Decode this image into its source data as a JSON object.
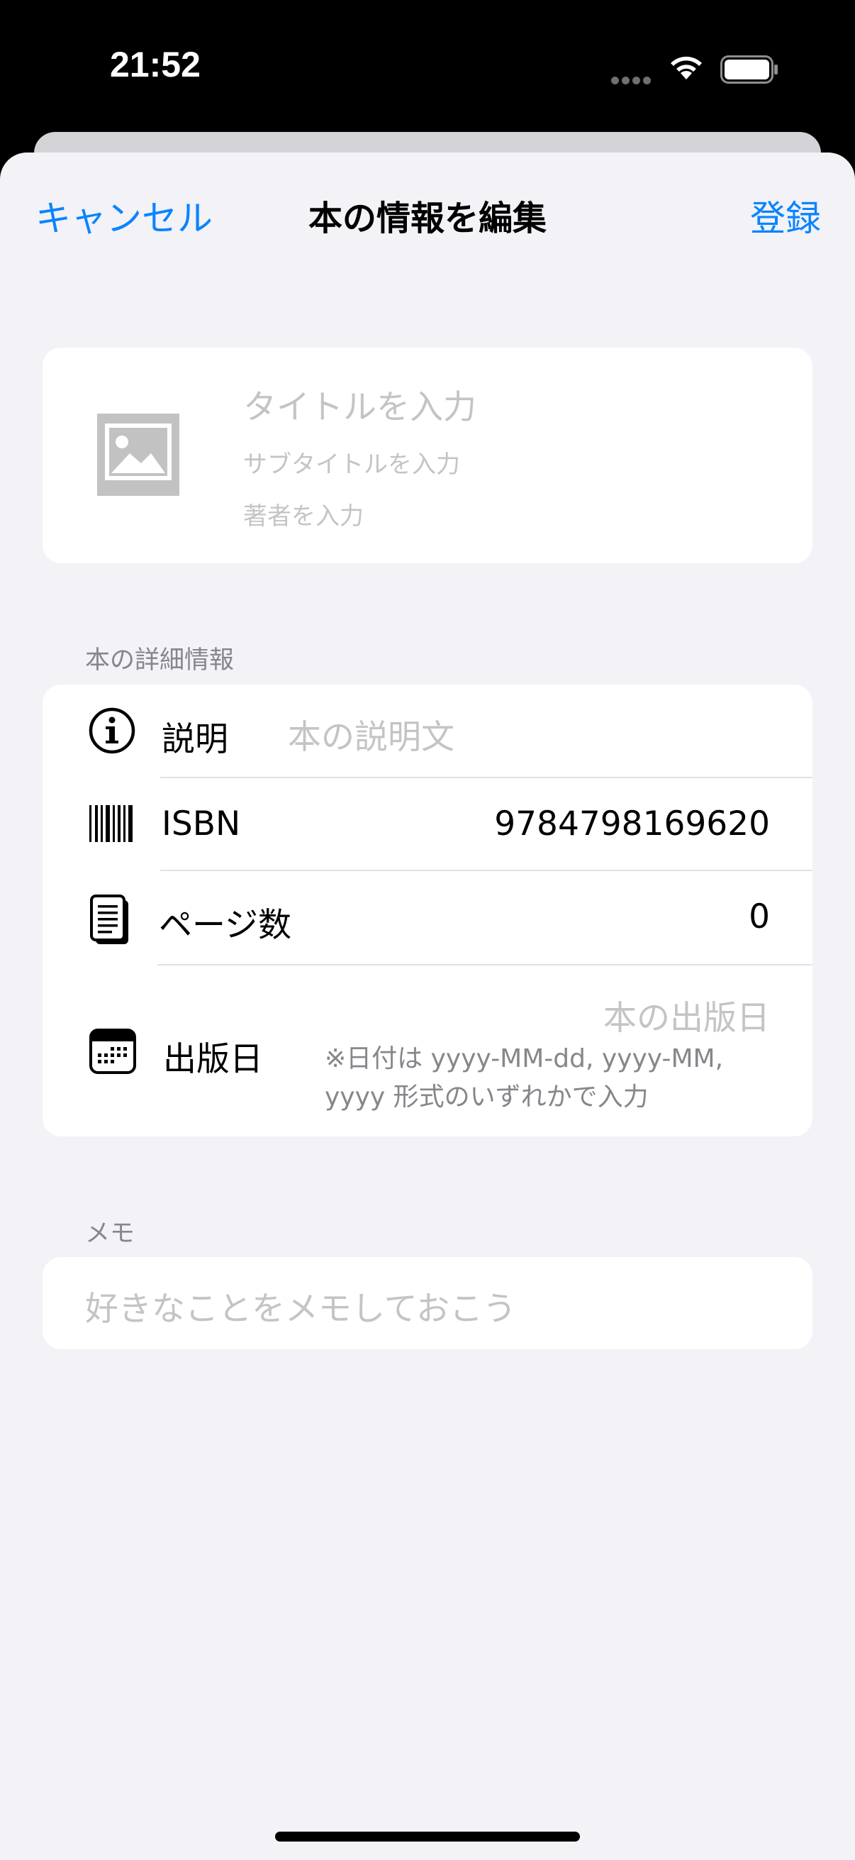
{
  "status": {
    "time": "21:52"
  },
  "nav": {
    "cancel": "キャンセル",
    "title": "本の情報を編集",
    "register": "登録"
  },
  "book": {
    "title_placeholder": "タイトルを入力",
    "subtitle_placeholder": "サブタイトルを入力",
    "author_placeholder": "著者を入力"
  },
  "details": {
    "header": "本の詳細情報",
    "description": {
      "label": "説明",
      "placeholder": "本の説明文"
    },
    "isbn": {
      "label": "ISBN",
      "value": "9784798169620"
    },
    "pages": {
      "label": "ページ数",
      "value": "0"
    },
    "published": {
      "label": "出版日",
      "placeholder": "本の出版日",
      "hint": "※日付は yyyy-MM-dd, yyyy-MM, yyyy 形式のいずれかで入力"
    }
  },
  "memo": {
    "header": "メモ",
    "placeholder": "好きなことをメモしておこう"
  },
  "icons": {
    "cover": "photo-placeholder-icon",
    "description": "info-circle-icon",
    "isbn": "barcode-icon",
    "pages": "document-pages-icon",
    "published": "calendar-icon"
  },
  "colors": {
    "accent": "#0a84ff",
    "background": "#f2f2f7",
    "placeholder": "#c4c4c7"
  }
}
